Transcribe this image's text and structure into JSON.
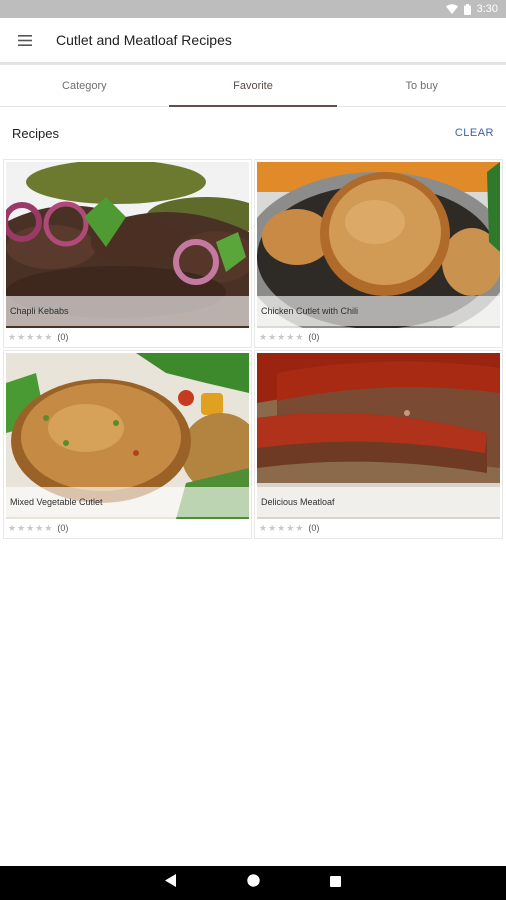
{
  "status_bar": {
    "time": "3:30",
    "icons": [
      "wifi-icon",
      "battery-icon"
    ]
  },
  "app_bar": {
    "title": "Cutlet and Meatloaf Recipes",
    "menu_icon": "hamburger-menu-icon"
  },
  "tabs": [
    {
      "label": "Category",
      "active": false
    },
    {
      "label": "Favorite",
      "active": true
    },
    {
      "label": "To buy",
      "active": false
    }
  ],
  "section": {
    "title": "Recipes",
    "clear_label": "CLEAR"
  },
  "recipes": [
    {
      "name": "Chapli Kebabs",
      "rating_count": "(0)",
      "stars": 0
    },
    {
      "name": "Chicken Cutlet with Chili",
      "rating_count": "(0)",
      "stars": 0
    },
    {
      "name": "Mixed Vegetable Cutlet",
      "rating_count": "(0)",
      "stars": 0
    },
    {
      "name": "Delicious Meatloaf",
      "rating_count": "(0)",
      "stars": 0
    }
  ],
  "nav_bar": {
    "icons": [
      "back-icon",
      "home-icon",
      "recents-icon"
    ]
  },
  "colors": {
    "accent": "#3f5fa8",
    "tab_indicator": "#5f5050",
    "status_bar": "#bdbdbd"
  }
}
